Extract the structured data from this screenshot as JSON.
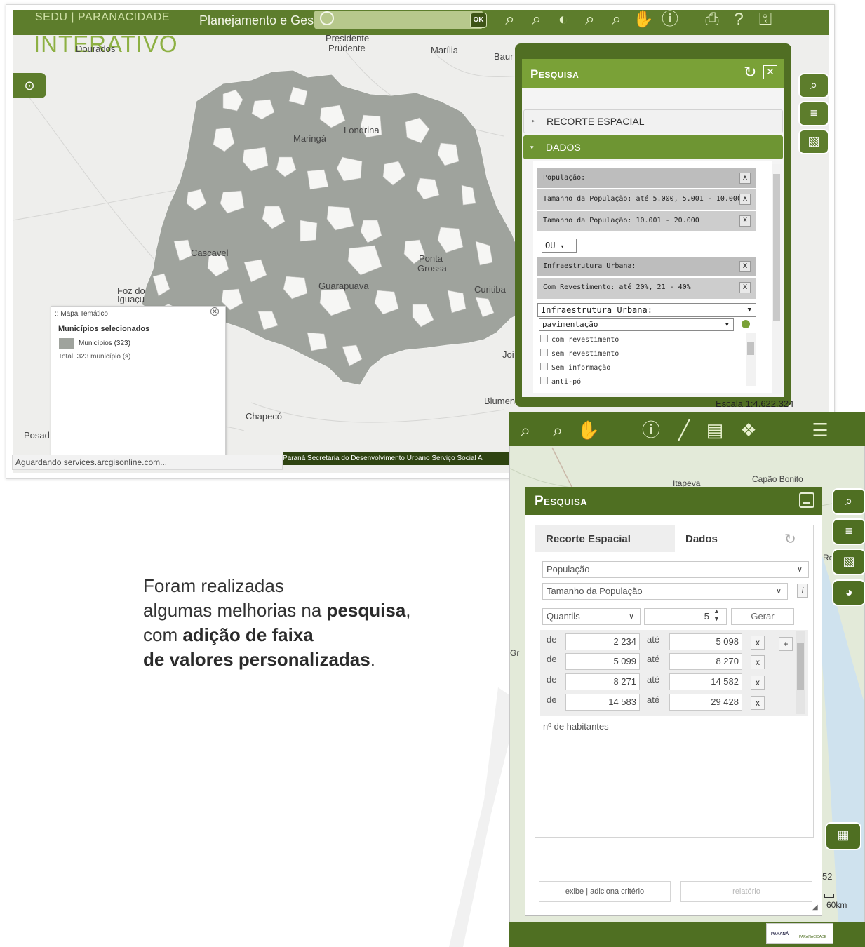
{
  "shot1": {
    "brand_top": "SEDU | PARANACIDADE",
    "brand_big": "INTERATIVO",
    "app_title": "Planejamento e Gest",
    "ok_label": "OK",
    "places": {
      "dourados": "Dourados",
      "presidente": "Presidente",
      "prudente": "Prudente",
      "marilia": "Marília",
      "bauru": "Baur",
      "maringa": "Maringá",
      "londrina": "Londrina",
      "cascavel": "Cascavel",
      "ponta": "Ponta",
      "grossa": "Grossa",
      "guarapuava": "Guarapuava",
      "curitiba": "Curitiba",
      "foz": "Foz do",
      "iguacu": "Iguaçu",
      "joi": "Joi",
      "blumen": "Blumen",
      "chapeco": "Chapecó",
      "posad": "Posad"
    },
    "panel": {
      "title": "Pesquisa",
      "acc_recorte": "RECORTE ESPACIAL",
      "acc_dados": "DADOS",
      "criteria": [
        {
          "label": "População:",
          "x": "X"
        },
        {
          "label": "Tamanho da População: até 5.000, 5.001 - 10.000",
          "x": "X"
        },
        {
          "label": "Tamanho da População: 10.001 - 20.000",
          "x": "X"
        }
      ],
      "ou": "OU",
      "criteria2": [
        {
          "label": "Infraestrutura Urbana:",
          "x": "X"
        },
        {
          "label": "Com Revestimento: até 20%, 21 - 40%",
          "x": "X"
        }
      ],
      "select_infra": "Infraestrutura Urbana:",
      "select_pav": "pavimentação",
      "checks": [
        "com revestimento",
        "sem revestimento",
        "Sem informação",
        "anti-pó"
      ]
    },
    "scale": "Escala 1:4.622.324",
    "legend": {
      "title": ":: Mapa Temático",
      "heading": "Municípios selecionados",
      "item": "Municípios (323)",
      "total": "Total: 323 município (s)"
    },
    "status": "Aguardando services.arcgisonline.com...",
    "footer": "Paraná   Secretaria do Desenvolvimento Urbano   Serviço Social A"
  },
  "description": {
    "line1": "Foram realizadas",
    "line2_pre": "algumas melhorias na ",
    "line2_bold": "pesquisa",
    "line2_post": ",",
    "line3_pre": "com ",
    "line3_bold": "adição de faixa",
    "line4_bold": "de valores personalizadas",
    "line4_post": "."
  },
  "shot2": {
    "places": {
      "itapeva": "Itapeva",
      "capao": "Capão Bonito",
      "gr": "Gr",
      "re": "Re",
      "num": "52"
    },
    "panel": {
      "title": "Pesquisa",
      "tab_recorte": "Recorte Espacial",
      "tab_dados": "Dados",
      "select1": "População",
      "select2": "Tamanho da População",
      "method": "Quantils",
      "classes": "5",
      "gerar": "Gerar",
      "de": "de",
      "ate": "até",
      "rows": [
        {
          "from": "2 234",
          "to": "5 098"
        },
        {
          "from": "5 099",
          "to": "8 270"
        },
        {
          "from": "8 271",
          "to": "14 582"
        },
        {
          "from": "14 583",
          "to": "29 428"
        }
      ],
      "x": "x",
      "plus": "+",
      "unit": "nº de habitantes",
      "btn_exibe": "exibe | adiciona critério",
      "btn_relatorio": "relatório"
    },
    "scale": "60km",
    "logo1": "PARANÁ",
    "logo2": "PARANACIDADE"
  },
  "colors": {
    "brand_green": "#5d7d2c",
    "dark_green": "#4f6f22",
    "light_green": "#7aa137",
    "map_gray": "#9fa39d"
  }
}
